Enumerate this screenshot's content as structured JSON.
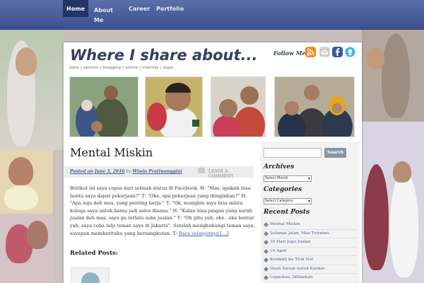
{
  "nav": {
    "items": [
      {
        "label": "Home",
        "active": true
      },
      {
        "label": "About Me"
      },
      {
        "label": "Career"
      },
      {
        "label": "Portfolio"
      }
    ]
  },
  "header": {
    "title": "Where I share about...",
    "tagline": "daily | opinion | blogging | online | internet | jogja",
    "follow_label": "Follow Me",
    "social_icons": [
      "rss-icon",
      "email-icon",
      "facebook-icon",
      "twitter-icon"
    ]
  },
  "post": {
    "title": "Mental Miskin",
    "posted_on_prefix": "Posted on",
    "date": "June 3, 2016",
    "by": "by",
    "author": "Wiwin Pratiwanggini",
    "comment_link": "LEAVE A COMMENT",
    "excerpt": "Berikut ini saya copas dari sebuah status di Facebook. H: \"Mas, apakah bisa bantu saya dapat pekerjaan?\" T: \"Oke, apa pekerjaan yang diinginkan?\" H: \"Apa saja deh mas, yang penting kerja.\" T: \"Ok, mungkin saya bisa minta kolega saya untuk kamu jadi sales disana.\" H: \"Kalau bisa jangan yang suruh jualan deh mas, saya ga terlalu suka jualan.\" T: \"Oh gitu yah, oke...oke bentar yah, saya coba telp teman saya di Jakarta\". Setelah menghubungi teman saya, sayapun memberitahu yang bersangkutan. T:",
    "read_more": "Baca selanjutnya [...]",
    "related_heading": "Related Posts:"
  },
  "sidebar": {
    "search_button": "Search",
    "archives_heading": "Archives",
    "archives_select": "Select Month",
    "categories_heading": "Categories",
    "categories_select": "Select Category",
    "recent_heading": "Recent Posts",
    "recent_posts": [
      "Mental Miskin",
      "Selamat Jalan, Mas Triyatno..",
      "30 Hari Jago Jualan",
      "19 April",
      "Kembali Ke Titik Nol",
      "Daun Sirsak untuk Kanker",
      "Lepaskan, Ikhlaskan"
    ]
  },
  "colors": {
    "nav": "#3b4f8e",
    "title": "#324062",
    "link": "#4a5e8f"
  }
}
